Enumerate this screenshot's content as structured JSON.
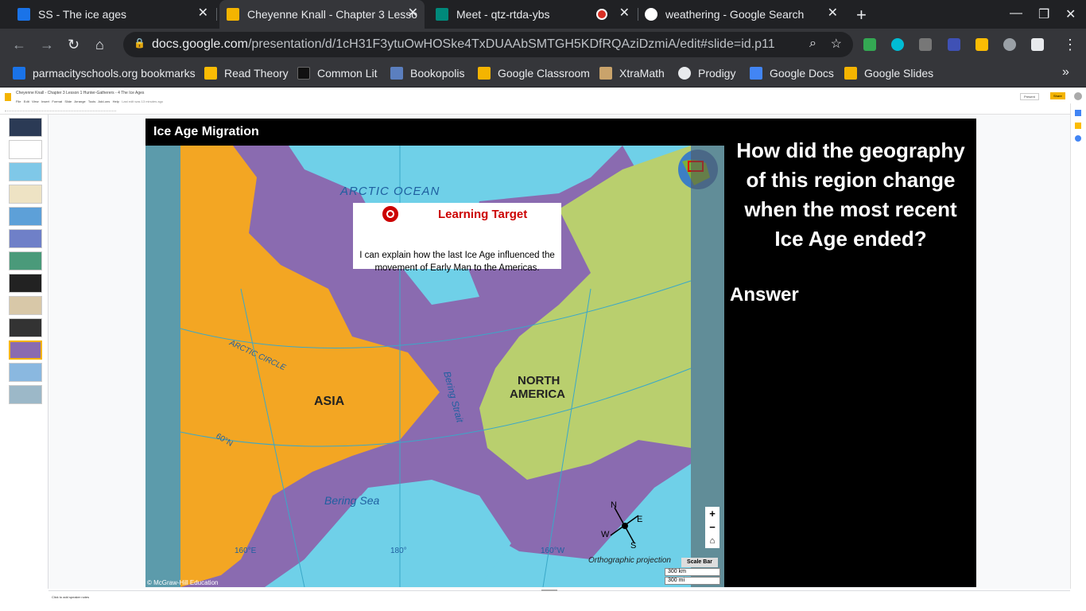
{
  "tabs": [
    {
      "title": "SS - The ice ages",
      "color": "#1a73e8"
    },
    {
      "title": "Cheyenne Knall - Chapter 3 Lesso",
      "color": "#f4b400"
    },
    {
      "title": "Meet - qtz-rtda-ybs",
      "color": "#00897b"
    },
    {
      "title": "",
      "color": "#d93025"
    },
    {
      "title": "weathering - Google Search",
      "color": "#ffffff"
    }
  ],
  "url": {
    "host": "docs.google.com",
    "path": "/presentation/d/1cH31F3ytuOwHOSke4TxDUAAbSMTGH5KDfRQAziDzmiA/edit#slide=id.p11"
  },
  "bookmarks": [
    "parmacityschools.org bookmarks",
    "Read Theory",
    "Common Lit",
    "Bookopolis",
    "Google Classroom",
    "XtraMath",
    "Prodigy",
    "Google Docs",
    "Google Slides"
  ],
  "docs": {
    "title": "Cheyenne Knall - Chapter 3 Lesson 1 Hunter-Gatherers - 4 The Ice Ages",
    "menus": [
      "File",
      "Edit",
      "View",
      "Insert",
      "Format",
      "Slide",
      "Arrange",
      "Tools",
      "Add-ons",
      "Help"
    ],
    "last_edit": "Last edit was 13 minutes ago",
    "present": "Present",
    "share": "Share"
  },
  "slide": {
    "title": "Ice Age Migration",
    "learning_target_title": "Learning Target",
    "learning_target_text": "I can explain how the last Ice Age influenced the movement of Early Man to the Americas.",
    "question": "How did the geography of this region change when the most recent Ice Age ended?",
    "answer_label": "Answer",
    "credit": "© McGraw-Hill Education",
    "map_labels": {
      "arctic_ocean": "ARCTIC OCEAN",
      "arctic_circle": "ARCTIC CIRCLE",
      "asia": "ASIA",
      "north_america_1": "NORTH",
      "north_america_2": "AMERICA",
      "bering_strait": "Bering Strait",
      "bering_sea": "Bering Sea",
      "lat60": "60°N",
      "lon160e": "160°E",
      "lon180": "180°",
      "lon160w": "160°W",
      "projection": "Orthographic projection",
      "scale_bar": "Scale Bar",
      "km": "300 km",
      "mi": "300 mi",
      "compass_n": "N",
      "compass_e": "E",
      "compass_s": "S",
      "compass_w": "W"
    }
  },
  "notes_placeholder": "Click to add speaker notes",
  "colors": {
    "ocean": "#6fd0e8",
    "asia": "#f3a623",
    "north_america": "#b9cf6e",
    "ice_land": "#8a6bb0"
  }
}
